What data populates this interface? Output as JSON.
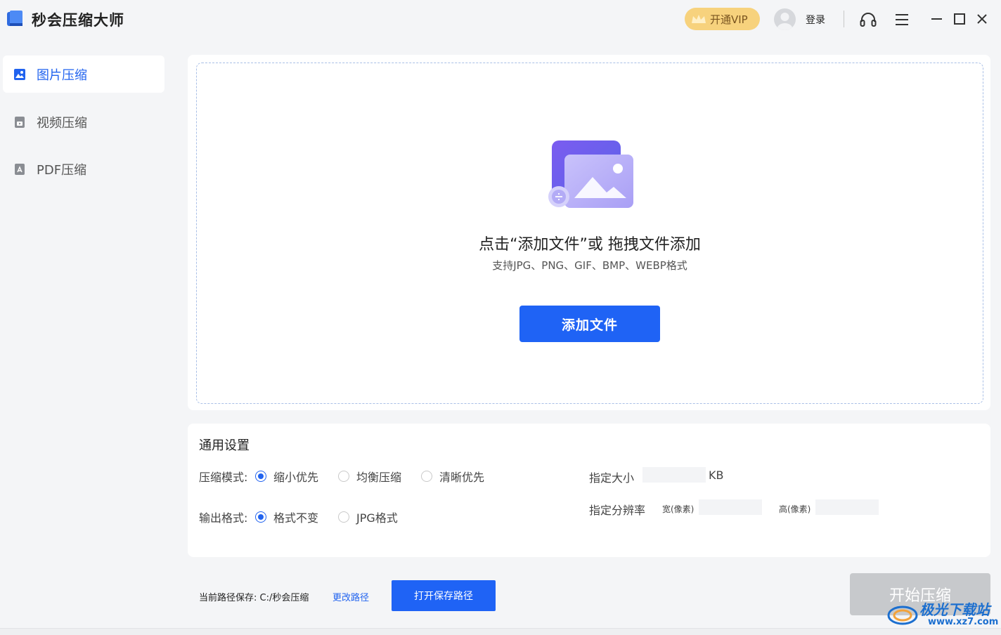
{
  "app": {
    "title": "秒会压缩大师"
  },
  "titlebar": {
    "vip_label": "开通VIP",
    "login_label": "登录",
    "icons": [
      "headset-icon",
      "menu-icon",
      "minimize-icon",
      "maximize-icon",
      "close-icon"
    ]
  },
  "sidebar": {
    "items": [
      {
        "label": "图片压缩",
        "icon": "image-icon",
        "active": true
      },
      {
        "label": "视频压缩",
        "icon": "video-icon",
        "active": false
      },
      {
        "label": "PDF压缩",
        "icon": "pdf-icon",
        "active": false
      }
    ]
  },
  "dropzone": {
    "title": "点击“添加文件”或 拖拽文件添加",
    "subtitle": "支持JPG、PNG、GIF、BMP、WEBP格式",
    "add_button": "添加文件"
  },
  "settings": {
    "title": "通用设置",
    "compress_mode_label": "压缩模式:",
    "compress_modes": [
      {
        "label": "缩小优先",
        "checked": true
      },
      {
        "label": "均衡压缩",
        "checked": false
      },
      {
        "label": "清晰优先",
        "checked": false
      }
    ],
    "output_format_label": "输出格式:",
    "output_formats": [
      {
        "label": "格式不变",
        "checked": true
      },
      {
        "label": "JPG格式",
        "checked": false
      }
    ],
    "size_label": "指定大小",
    "size_value": "",
    "size_unit": "KB",
    "resolution_label": "指定分辨率",
    "width_label": "宽(像素)",
    "width_value": "",
    "height_label": "高(像素)",
    "height_value": ""
  },
  "footer": {
    "path_label": "当前路径保存: C:/秒会压缩",
    "change_path": "更改路径",
    "open_path_button": "打开保存路径",
    "start_button": "开始压缩"
  },
  "watermark": {
    "line1": "极光下载站",
    "line2": "www.xz7.com"
  },
  "colors": {
    "accent": "#1f63f5",
    "vip": "#f7d27d",
    "disabled": "#c7c9cc"
  }
}
